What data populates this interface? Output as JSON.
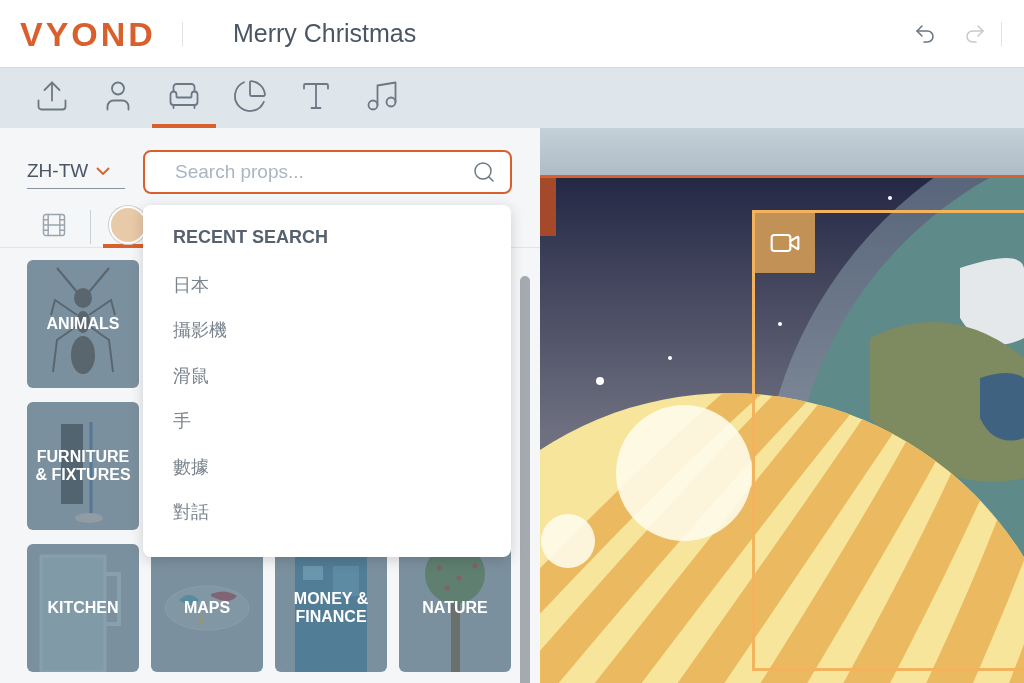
{
  "header": {
    "logo": "VYOND",
    "title": "Merry Christmas"
  },
  "toolbar": [
    {
      "kind": "upload",
      "selected": false
    },
    {
      "kind": "character",
      "selected": false
    },
    {
      "kind": "prop",
      "selected": true
    },
    {
      "kind": "chart",
      "selected": false
    },
    {
      "kind": "text",
      "selected": false
    },
    {
      "kind": "music",
      "selected": false
    }
  ],
  "language": "ZH-TW",
  "search": {
    "placeholder": "Search props..."
  },
  "subtabs": [
    {
      "kind": "scene",
      "selected": false
    },
    {
      "kind": "avatar",
      "selected": true
    }
  ],
  "recent": {
    "heading": "RECENT SEARCH",
    "items": [
      "日本",
      "攝影機",
      "滑鼠",
      "手",
      "數據",
      "對話"
    ]
  },
  "category_rows": [
    [
      {
        "label": "ANIMALS",
        "kind": "ant"
      }
    ],
    [
      {
        "label": "FURNITURE & FIXTURES",
        "kind": "lamp"
      }
    ],
    [
      {
        "label": "KITCHEN",
        "kind": "mug"
      },
      {
        "label": "MAPS",
        "kind": "map"
      },
      {
        "label": "MONEY & FINANCE",
        "kind": "atm"
      },
      {
        "label": "NATURE",
        "kind": "tree"
      }
    ]
  ]
}
